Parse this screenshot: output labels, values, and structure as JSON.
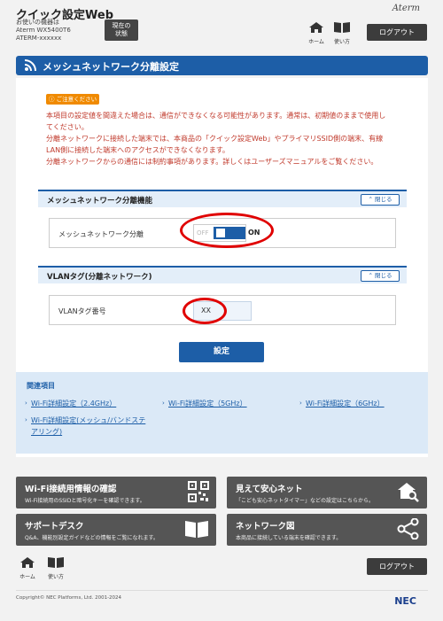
{
  "header": {
    "app_title": "クイック設定Web",
    "device_label": "お使いの機器は",
    "device_model": "Aterm WX5400T6",
    "device_id": "ATERM-xxxxxx",
    "status_button": [
      "現在の",
      "状態"
    ],
    "brand": "Aterm",
    "home_label": "ホーム",
    "manual_label": "使い方",
    "logout_label": "ログアウト"
  },
  "page": {
    "title": "メッシュネットワーク分離設定"
  },
  "caution": {
    "badge": "ご注意ください",
    "lines": [
      "本項目の設定値を間違えた場合は、通信ができなくなる可能性があります。通常は、初期値のままで使用し",
      "てください。",
      "分離ネットワークに接続した端末では、本商品の「クイック設定Web」やプライマリSSID側の端末、有線",
      "LAN側に接続した端末へのアクセスができなくなります。",
      "分離ネットワークからの通信には制約事項があります。詳しくはユーザーズマニュアルをご覧ください。"
    ]
  },
  "section_mesh": {
    "title": "メッシュネットワーク分離機能",
    "close_label": "閉じる",
    "row_label": "メッシュネットワーク分離",
    "toggle_off": "OFF",
    "toggle_on": "ON",
    "toggle_state": "on"
  },
  "section_vlan": {
    "title": "VLANタグ(分離ネットワーク)",
    "close_label": "閉じる",
    "row_label": "VLANタグ番号",
    "value": "XX"
  },
  "submit_label": "設定",
  "related": {
    "title": "関連項目",
    "links": [
      "Wi-Fi詳細設定（2.4GHz）",
      "Wi-Fi詳細設定（5GHz）",
      "Wi-Fi詳細設定（6GHz）",
      [
        "Wi-Fi詳細設定(メッシュ/バンドステ",
        "アリング)"
      ]
    ]
  },
  "tiles": [
    {
      "title": "Wi-Fi接続用情報の確認",
      "sub": "Wi-Fi接続用のSSIDと暗号化キーを確認できます。",
      "icon": "qr-code-icon"
    },
    {
      "title": "見えて安心ネット",
      "sub": "「こども安心ネットタイマー」などの設定はこちらから。",
      "icon": "home-search-icon"
    },
    {
      "title": "サポートデスク",
      "sub": "Q&A、機能別設定ガイドなどの情報をご覧になれます。",
      "icon": "book-icon"
    },
    {
      "title": "ネットワーク図",
      "sub": "本商品に接続している端末を確認できます。",
      "icon": "share-icon"
    }
  ],
  "footer": {
    "home_label": "ホーム",
    "manual_label": "使い方",
    "logout_label": "ログアウト",
    "copyright": "Copyright© NEC Platforms, Ltd. 2001-2024",
    "logo": "NEC"
  },
  "colors": {
    "accent": "#1d5ea7",
    "caution_text": "#c0392b",
    "caution_badge": "#f08a00",
    "highlight_ring": "#e00000",
    "tile_bg": "#555555"
  }
}
